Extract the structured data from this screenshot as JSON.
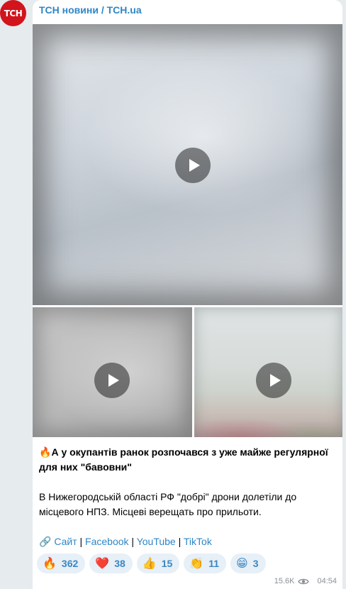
{
  "channel": {
    "avatar_text": "TCH",
    "name": "ТСН новини / TCH.ua",
    "brand_color": "#d2141c"
  },
  "post": {
    "media_icons": [
      "play-icon",
      "play-icon",
      "play-icon"
    ],
    "headline_emoji": "🔥",
    "headline": "А у окупантів ранок розпочався з уже майже регулярної для них \"бавовни\"",
    "body": "В Нижегородській області РФ \"добрі\" дрони долетіли до місцевого НПЗ. Місцеві верещать про прильоти.",
    "links": {
      "icon": "🔗",
      "items": [
        "Сайт",
        "Facebook",
        "YouTube",
        "TikTok"
      ],
      "separator": "|"
    },
    "reactions": [
      {
        "emoji": "🔥",
        "count": "362"
      },
      {
        "emoji": "❤️",
        "count": "38"
      },
      {
        "emoji": "👍",
        "count": "15"
      },
      {
        "emoji": "👏",
        "count": "11"
      },
      {
        "emoji": "😁",
        "count": "3"
      }
    ],
    "views": "15.6K",
    "time": "04:54",
    "link_color": "#2f86c6"
  }
}
